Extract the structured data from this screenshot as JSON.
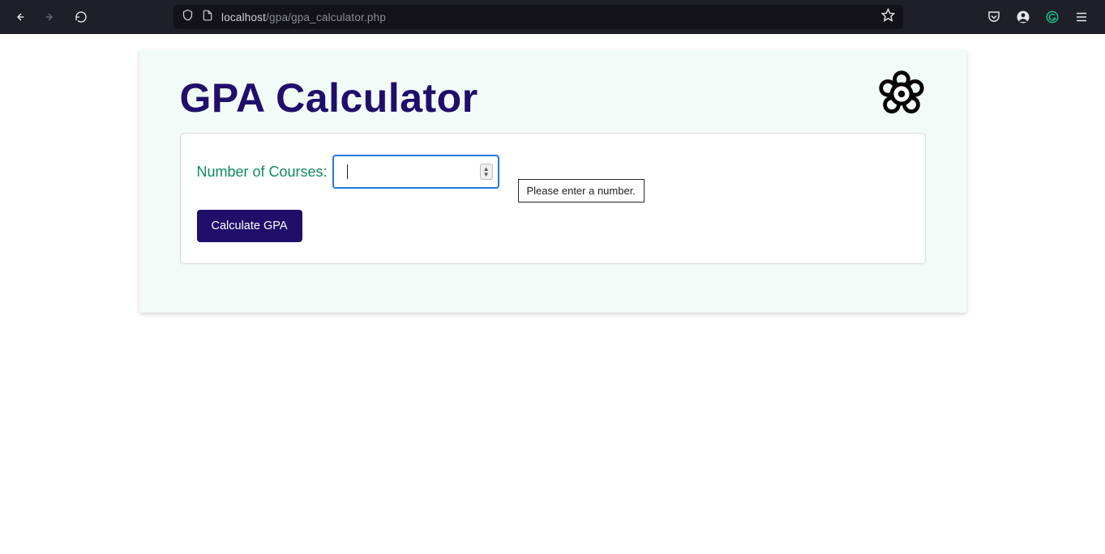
{
  "browser": {
    "url_host": "localhost",
    "url_path": "/gpa/gpa_calculator.php"
  },
  "page": {
    "title": "GPA Calculator",
    "form": {
      "courses_label": "Number of Courses:",
      "courses_value": "",
      "validation_message": "Please enter a number.",
      "submit_label": "Calculate GPA"
    }
  }
}
